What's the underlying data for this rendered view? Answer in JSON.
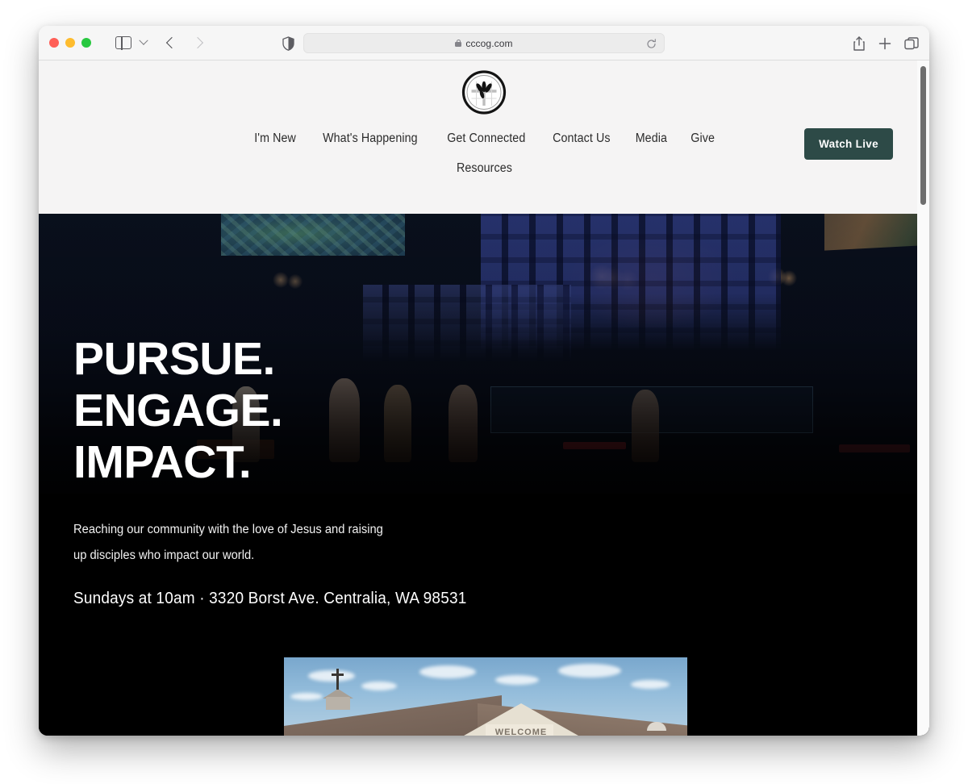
{
  "browser": {
    "window_controls": [
      "close",
      "minimize",
      "maximize"
    ],
    "sidebar_toggle": "sidebar-toggle",
    "tab_overview_chevron": "chevron-down",
    "back_label": "Back",
    "forward_label": "Forward",
    "shield_label": "Privacy Report",
    "url": "cccog.com",
    "lock": "secure-lock",
    "reload_label": "Reload",
    "actions": {
      "share": "Share",
      "new_tab": "New Tab",
      "tabs_overview": "Show Tab Overview"
    }
  },
  "site": {
    "logo_alt": "Centralia Community Church of God logo",
    "nav": {
      "row1": [
        {
          "label": "I'm New"
        },
        {
          "label": "What's Happening"
        },
        {
          "label": "Get Connected"
        },
        {
          "label": "Contact Us"
        },
        {
          "label": "Media"
        },
        {
          "label": "Give"
        }
      ],
      "row2": [
        {
          "label": "Resources"
        }
      ]
    },
    "cta": {
      "watch_live": "Watch Live"
    },
    "hero": {
      "line1": "PURSUE.",
      "line2": "ENGAGE.",
      "line3": "IMPACT.",
      "subtitle": "Reaching our community with the love of Jesus and raising up disciples who impact our world.",
      "meta": "Sundays at 10am  ·  3320 Borst Ave. Centralia, WA 98531",
      "background_alt": "Worship band leading music on stage with audience silhouettes"
    },
    "secondary_image": {
      "alt": "Church building exterior with cross and welcome sign",
      "sign_text": "WELCOME"
    }
  },
  "colors": {
    "accent_teal": "#2d4a47",
    "header_bg": "#f5f4f4",
    "hero_bg": "#000000",
    "toolbar_bg": "#f6f6f6",
    "nav_text": "#2b2b2b"
  }
}
